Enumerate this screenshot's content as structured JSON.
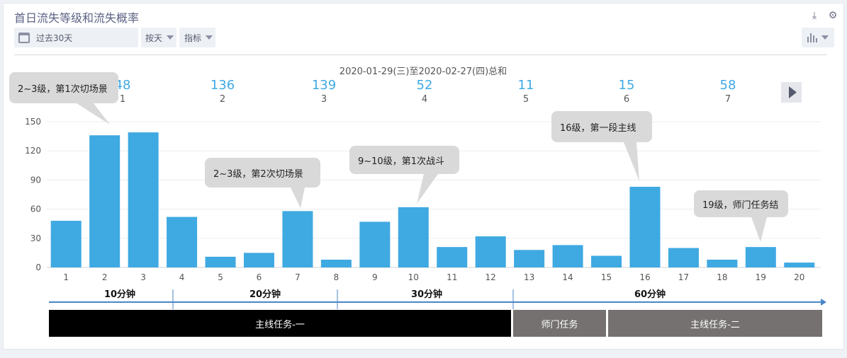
{
  "header": {
    "title": "首日流失等级和流失概率",
    "date_range": "过去30天",
    "granularity": "按天",
    "metric": "指标",
    "icons": [
      "download-icon",
      "gear-icon",
      "bar-chart-icon"
    ]
  },
  "chart_data": {
    "type": "bar",
    "subtitle": "2020-01-29(三)至2020-02-27(四)总和",
    "categories": [
      "1",
      "2",
      "3",
      "4",
      "5",
      "6",
      "7",
      "8",
      "9",
      "10",
      "11",
      "12",
      "13",
      "14",
      "15",
      "16",
      "17",
      "18",
      "19",
      "20"
    ],
    "values": [
      48,
      136,
      139,
      52,
      11,
      15,
      58,
      8,
      47,
      62,
      21,
      32,
      18,
      23,
      12,
      83,
      20,
      8,
      21,
      5
    ],
    "ylim": [
      0,
      150
    ],
    "yticks": [
      0,
      30,
      60,
      90,
      120,
      150
    ],
    "grid": true,
    "bar_color": "#3fa9e2",
    "summary": [
      {
        "value": "136",
        "label": "2"
      },
      {
        "value": "139",
        "label": "3"
      },
      {
        "value": "52",
        "label": "4"
      },
      {
        "value": "11",
        "label": "5"
      },
      {
        "value": "15",
        "label": "6"
      },
      {
        "value": "58",
        "label": "7"
      }
    ],
    "summary_partial": {
      "value": "48",
      "label": "1"
    },
    "callouts": [
      {
        "text": "2~3级，第1次切场景"
      },
      {
        "text": "2~3级，第2次切场景"
      },
      {
        "text": "9~10级，第1次战斗"
      },
      {
        "text": "16级，第一段主线"
      },
      {
        "text": "19级，师门任务结"
      }
    ],
    "time_phases": [
      "10分钟",
      "20分钟",
      "30分钟",
      "60分钟"
    ],
    "tasks": [
      {
        "label": "主线任务-一",
        "color": "#000000"
      },
      {
        "label": "师门任务",
        "color": "#747170"
      },
      {
        "label": "主线任务-二",
        "color": "#747170"
      }
    ]
  }
}
